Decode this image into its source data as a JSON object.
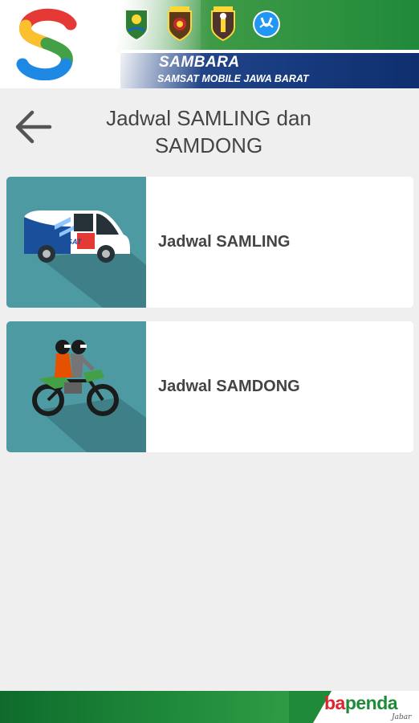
{
  "header": {
    "brand_title": "SAMBARA",
    "brand_subtitle": "SAMSAT MOBILE JAWA BARAT",
    "logo_icon": "sambara-s-logo-icon",
    "emblems": [
      "jawa-barat-emblem-icon",
      "polda-jabar-emblem-icon",
      "polri-emblem-icon",
      "jasa-raharja-emblem-icon"
    ]
  },
  "page": {
    "title": "Jadwal SAMLING dan SAMDONG",
    "back_icon": "arrow-left-icon"
  },
  "menu": [
    {
      "label": "Jadwal SAMLING",
      "icon": "samsat-keliling-van-icon",
      "van_text": "SAMSAT"
    },
    {
      "label": "Jadwal SAMDONG",
      "icon": "motorbike-riders-icon"
    }
  ],
  "footer": {
    "brand_part1": "ba",
    "brand_part2": "penda",
    "brand_sub": "Jabar"
  },
  "colors": {
    "card_image_bg": "#4e9aa2",
    "header_green": "#1f8a3a",
    "header_blue": "#163a7e",
    "bapenda_red": "#e0242b"
  }
}
